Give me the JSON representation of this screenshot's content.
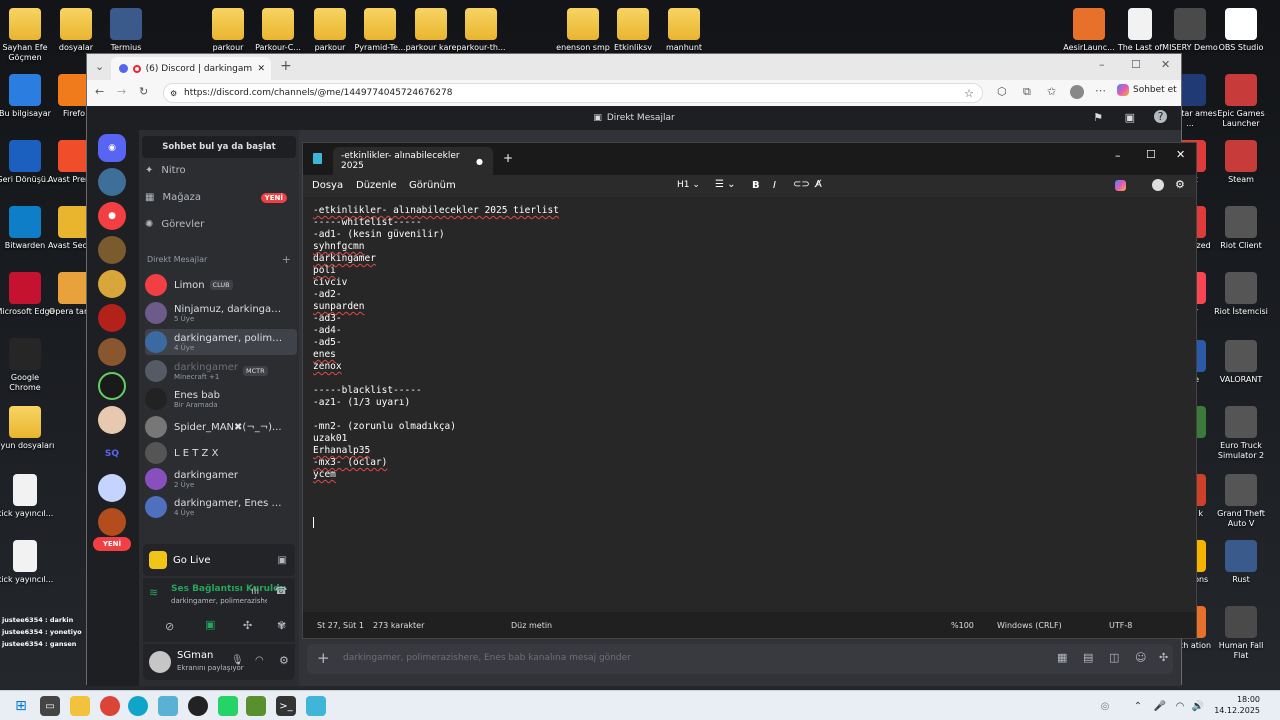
{
  "desktop": {
    "icons": [
      {
        "label": "Sayhan Efe Göçmen",
        "type": "folder"
      },
      {
        "label": "dosyalar",
        "type": "folder"
      },
      {
        "label": "Termius",
        "type": "app"
      },
      {
        "label": "parkour",
        "type": "folder"
      },
      {
        "label": "Parkour-C...",
        "type": "folder"
      },
      {
        "label": "parkour",
        "type": "folder"
      },
      {
        "label": "Pyramid-Te...",
        "type": "folder"
      },
      {
        "label": "parkour kare",
        "type": "folder"
      },
      {
        "label": "parkour-th...",
        "type": "folder"
      },
      {
        "label": "enenson smp",
        "type": "folder"
      },
      {
        "label": "Etkinliksv",
        "type": "folder"
      },
      {
        "label": "manhunt",
        "type": "folder"
      },
      {
        "label": "AesirLaunc...",
        "type": "app"
      },
      {
        "label": "The Last of",
        "type": "doc"
      },
      {
        "label": "MISERY Demo",
        "type": "app"
      },
      {
        "label": "OBS Studio",
        "type": "app"
      },
      {
        "label": "Bu bilgisayar",
        "type": "app"
      },
      {
        "label": "Firefo",
        "type": "app"
      },
      {
        "label": "Geri Dönüşü...",
        "type": "app"
      },
      {
        "label": "Avast Premiu",
        "type": "app"
      },
      {
        "label": "Bitwarden",
        "type": "app"
      },
      {
        "label": "Avast Secure",
        "type": "app"
      },
      {
        "label": "Microsoft Edge",
        "type": "app"
      },
      {
        "label": "Opera tarayı",
        "type": "app"
      },
      {
        "label": "Google Chrome",
        "type": "app"
      },
      {
        "label": "oyun dosyaları",
        "type": "folder"
      },
      {
        "label": "kick yayıncıl...",
        "type": "doc"
      },
      {
        "label": "kick yayıncıl...",
        "type": "doc"
      },
      {
        "label": "ockstar ames ...",
        "type": "app"
      },
      {
        "label": "Epic Games Launcher",
        "type": "app"
      },
      {
        "label": "ight",
        "type": "app"
      },
      {
        "label": "Steam",
        "type": "app"
      },
      {
        "label": "ends! ized",
        "type": "app"
      },
      {
        "label": "Riot Client",
        "type": "app"
      },
      {
        "label": "nter",
        "type": "app"
      },
      {
        "label": "Riot İstemcisi",
        "type": "app"
      },
      {
        "label": "orge",
        "type": "app"
      },
      {
        "label": "VALORANT",
        "type": "app"
      },
      {
        "label": "ter",
        "type": "app"
      },
      {
        "label": "Euro Truck Simulator 2",
        "type": "app"
      },
      {
        "label": "oose k",
        "type": "app"
      },
      {
        "label": "Grand Theft Auto V",
        "type": "app"
      },
      {
        "label": "yond ons",
        "type": "app"
      },
      {
        "label": "Rust",
        "type": "app"
      },
      {
        "label": "anch ation",
        "type": "app"
      },
      {
        "label": "Human Fall Flat",
        "type": "app"
      }
    ],
    "overlay_lines": [
      "justee6354 : darkin",
      "justee6354 : yonetiyo",
      "justee6354 : gansen"
    ]
  },
  "browser": {
    "tab_title": "(6) Discord | darkingamer, po",
    "url": "https://discord.com/channels/@me/1449774045724676278",
    "sohbet_label": "Sohbet et"
  },
  "discord": {
    "window_title": "Direkt Mesajlar",
    "search_placeholder": "Sohbet bul ya da başlat",
    "nav": [
      {
        "label": "Nitro",
        "badge": ""
      },
      {
        "label": "Mağaza",
        "badge": "YENİ"
      },
      {
        "label": "Görevler",
        "badge": ""
      }
    ],
    "dm_header": "Direkt Mesajlar",
    "dms": [
      {
        "name": "Limon",
        "sub": "",
        "tag": "CLUB",
        "color": "#f23f43"
      },
      {
        "name": "Ninjamuz, darkingame...",
        "sub": "5 Üye",
        "tag": "",
        "color": "#6d5b8c"
      },
      {
        "name": "darkingamer, polimer...",
        "sub": "4 Üye",
        "tag": "",
        "color": "#3b6aa0"
      },
      {
        "name": "darkingamer",
        "sub": "Minecraft +1",
        "tag": "MCTR",
        "color": "#555a64"
      },
      {
        "name": "Enes bab",
        "sub": "Bir Aramada",
        "tag": "",
        "color": "#222"
      },
      {
        "name": "Spider_MAN✖(¬_¬)...",
        "sub": "",
        "tag": "",
        "color": "#777"
      },
      {
        "name": "L E T Z X",
        "sub": "",
        "tag": "",
        "color": "#555"
      },
      {
        "name": "darkingamer",
        "sub": "2 Üye",
        "tag": "",
        "color": "#8a4fbf"
      },
      {
        "name": "darkingamer, Enes ba...",
        "sub": "4 Üye",
        "tag": "",
        "color": "#4f6fbf"
      }
    ],
    "rail_badge": "YENİ",
    "go_live": "Go Live",
    "voice_status": "Ses Bağlantısı Kuruldu",
    "voice_channel": "darkingamer, polimerazishere...",
    "user_name": "SGman",
    "user_status": "Ekranını paylaşıyor",
    "message_placeholder": "darkingamer, polimerazishere, Enes bab kanalına mesaj gönder"
  },
  "notepad": {
    "tab_title": "-etkinlikler- alınabilecekler 2025",
    "menu": [
      "Dosya",
      "Düzenle",
      "Görünüm"
    ],
    "heading_select": "H1",
    "lines": [
      "-etkinlikler- alınabilecekler 2025 tierlist",
      "-----whitelist-----",
      "-ad1- (kesin güvenilir)",
      "syhnfgcmn",
      "darkingamer",
      "poli",
      "civciv",
      "-ad2-",
      "sunparden",
      "-ad3-",
      "-ad4-",
      "-ad5-",
      "enes",
      "zenox",
      "",
      "-----blacklist-----",
      "-az1- (1/3 uyarı)",
      "",
      "-mn2- (zorunlu olmadıkça)",
      "uzak01",
      "Erhanalp35",
      "-mx3- (oclar)",
      "ycem"
    ],
    "status": {
      "position": "St 27, Süt 1",
      "chars": "273 karakter",
      "mode": "Düz metin",
      "zoom": "%100",
      "eol": "Windows (CRLF)",
      "encoding": "UTF-8"
    }
  },
  "taskbar": {
    "time": "18:00",
    "date": "14.12.2025"
  }
}
